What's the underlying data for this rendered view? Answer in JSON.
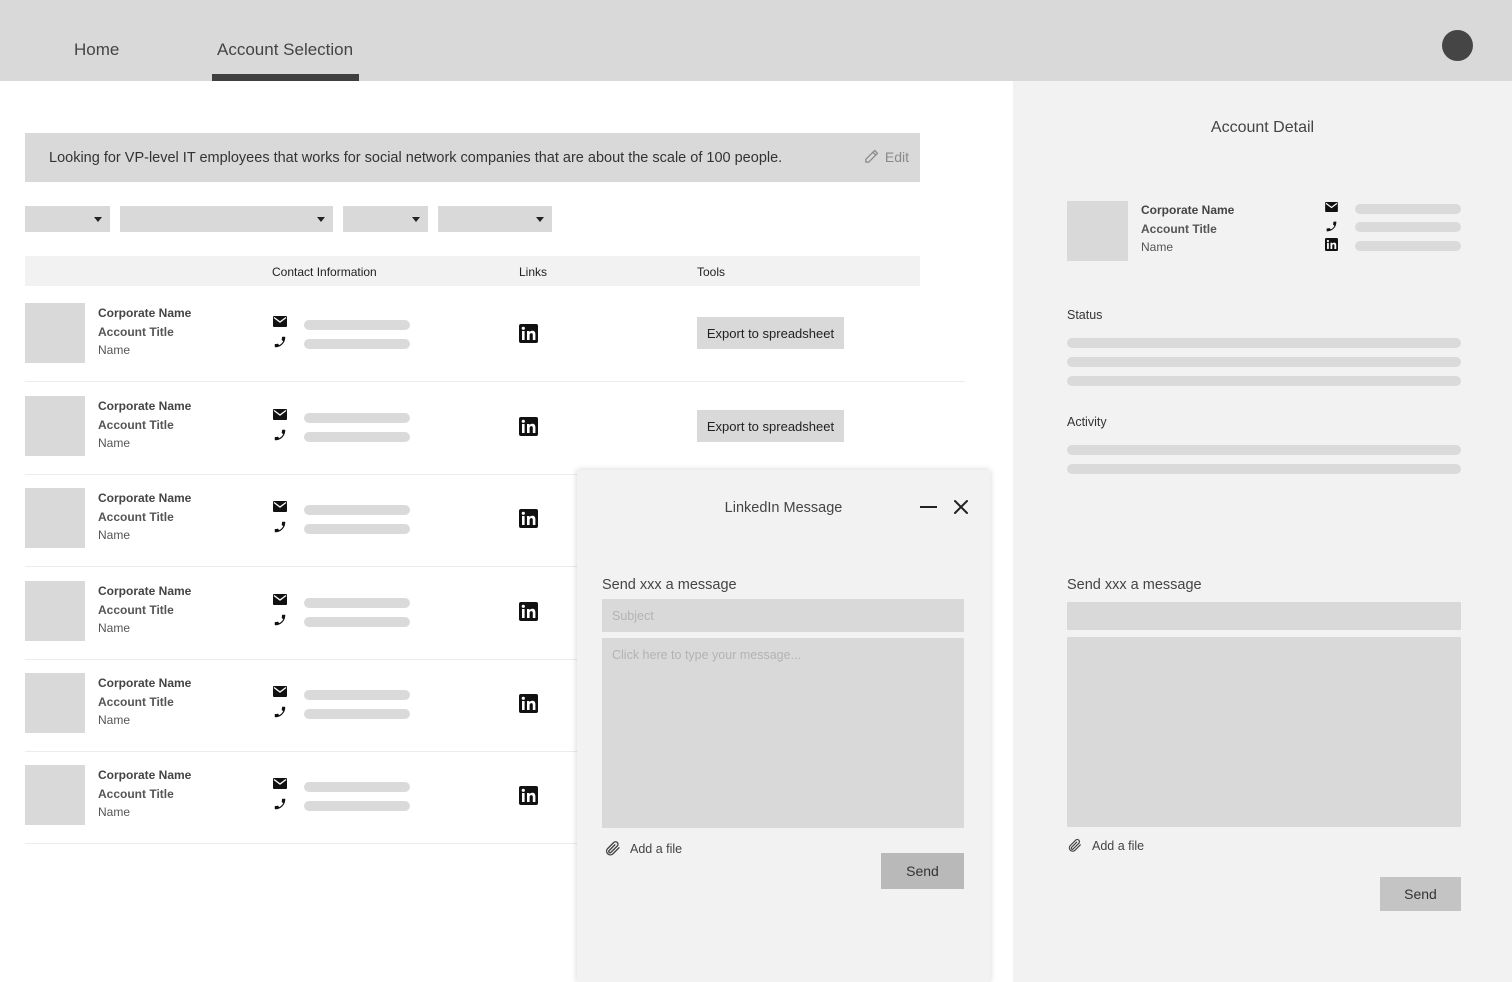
{
  "nav": {
    "tabs": [
      {
        "label": "Home"
      },
      {
        "label": "Account Selection"
      }
    ]
  },
  "query": {
    "text": "Looking for VP-level IT employees that works for social network companies that are about the scale of 100 people.",
    "edit_label": "Edit"
  },
  "table": {
    "headers": [
      "Contact Information",
      "Links",
      "Tools"
    ],
    "rows": [
      {
        "corporate": "Corporate Name",
        "title": "Account Title",
        "name": "Name",
        "tool": "Export to spreadsheet"
      },
      {
        "corporate": "Corporate Name",
        "title": "Account Title",
        "name": "Name",
        "tool": "Export to spreadsheet"
      },
      {
        "corporate": "Corporate Name",
        "title": "Account Title",
        "name": "Name",
        "tool": ""
      },
      {
        "corporate": "Corporate Name",
        "title": "Account Title",
        "name": "Name",
        "tool": ""
      },
      {
        "corporate": "Corporate Name",
        "title": "Account Title",
        "name": "Name",
        "tool": ""
      },
      {
        "corporate": "Corporate Name",
        "title": "Account Title",
        "name": "Name",
        "tool": ""
      }
    ]
  },
  "detail": {
    "title": "Account Detail",
    "corporate": "Corporate Name",
    "account_title": "Account Title",
    "name": "Name",
    "status_label": "Status",
    "activity_label": "Activity",
    "send_label": "Send xxx a message",
    "add_file": "Add a file",
    "send_button": "Send"
  },
  "modal": {
    "title": "LinkedIn Message",
    "send_label": "Send xxx a message",
    "subject_placeholder": "Subject",
    "message_placeholder": "Click here to type your message...",
    "add_file": "Add a file",
    "send_button": "Send"
  },
  "icons": {
    "mail": "mail-icon",
    "phone": "phone-icon",
    "linkedin": "linkedin-icon",
    "pencil": "pencil-icon",
    "paperclip": "paperclip-icon",
    "minimize": "minimize-icon",
    "close": "close-icon"
  }
}
